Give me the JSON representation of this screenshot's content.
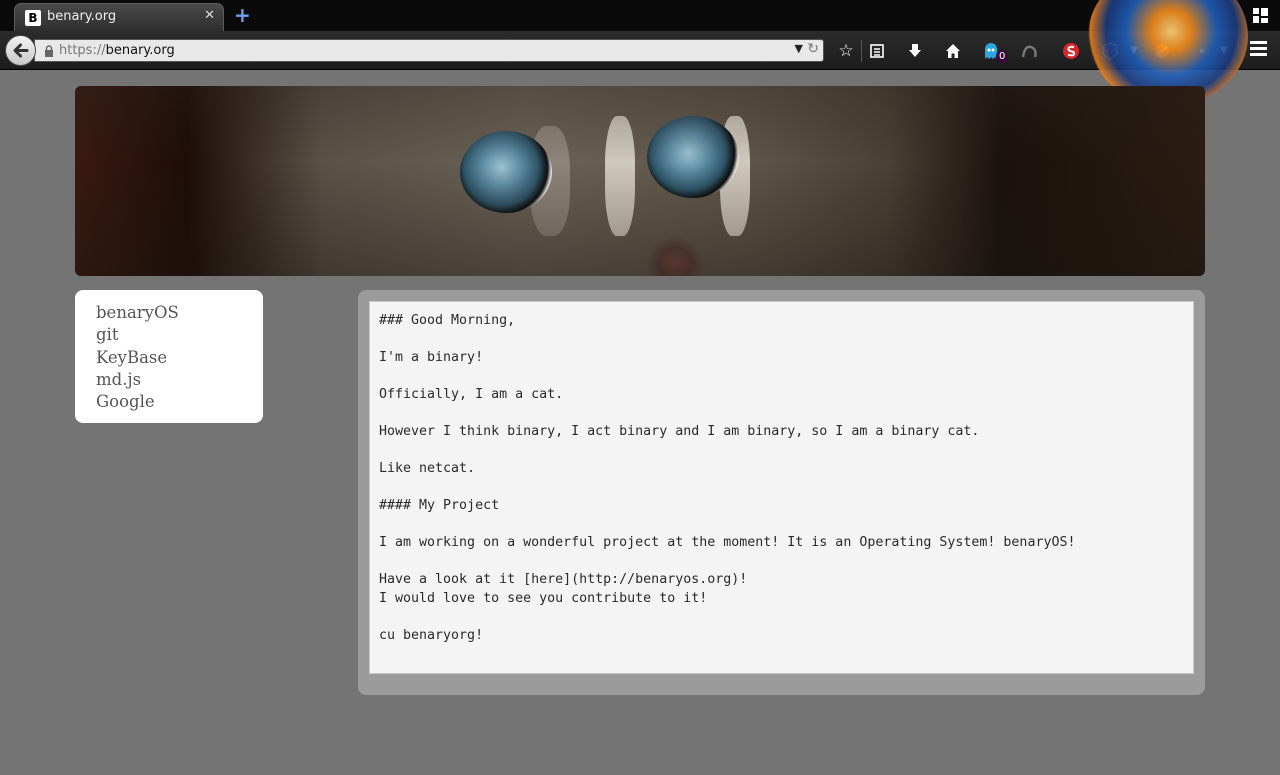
{
  "browser": {
    "tab": {
      "favicon": "B",
      "title": "benary.org",
      "close": "✕"
    },
    "new_tab": "+",
    "url": {
      "scheme": "https://",
      "host": "benary.org"
    },
    "toolbar_icons": [
      "star-icon",
      "reading-list-icon",
      "download-icon",
      "home-icon",
      "ghostery-icon",
      "extension-icon",
      "stylish-icon",
      "adblock-icon",
      "extension-icon-2",
      "extension-icon-3",
      "menu-icon"
    ],
    "ghostery_count": "0"
  },
  "sidebar": {
    "links": [
      "benaryOS",
      "git",
      "KeyBase",
      "md.js",
      "Google"
    ]
  },
  "editor": {
    "lines": [
      "### Good Morning,",
      "",
      "I'm a binary!",
      "",
      "Officially, I am a cat.",
      "",
      "However I think binary, I act binary and I am binary, so I am a binary cat.",
      "",
      "Like netcat.",
      "",
      "#### My Project",
      "",
      "I am working on a wonderful project at the moment! It is an Operating System! benaryOS!",
      "",
      "Have a look at it [here](http://benaryos.org)!",
      "I would love to see you contribute to it!",
      "",
      "cu benaryorg!"
    ]
  },
  "colors": {
    "page_background": "#747474",
    "panel_background": "#9b9b9b",
    "editor_background": "#f4f4f4",
    "sidebar_background": "#ffffff",
    "link_color": "#555555"
  }
}
